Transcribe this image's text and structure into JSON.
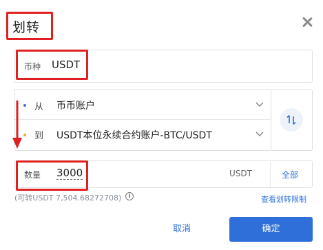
{
  "dialog": {
    "title": "划转",
    "close_icon": "close-icon"
  },
  "coin": {
    "label": "币种",
    "value": "USDT"
  },
  "transfer": {
    "from_label": "从",
    "from_value": "币币账户",
    "to_label": "到",
    "to_value": "USDT本位永续合约账户-BTC/USDT",
    "swap_icon": "swap-vertical-icon"
  },
  "amount": {
    "label": "数量",
    "value": "3000",
    "unit": "USDT",
    "all_label": "全部"
  },
  "available": {
    "text": "(可转USDT 7,504.68272708)",
    "info_icon": "info-icon"
  },
  "limit_link": "查看划转限制",
  "actions": {
    "cancel": "取消",
    "confirm": "确定"
  },
  "colors": {
    "accent": "#2e6fd9",
    "highlight": "#e02020",
    "from_dot": "#3a7bd5",
    "to_dot": "#f5a623"
  }
}
